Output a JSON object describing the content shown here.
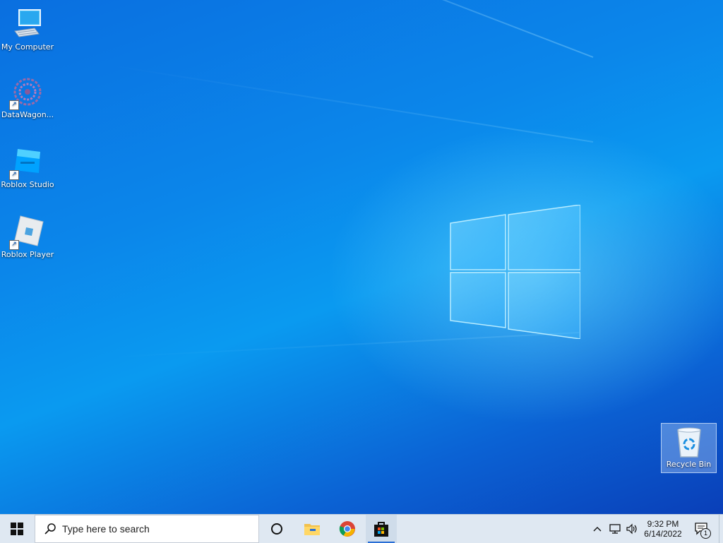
{
  "desktop": {
    "icons": [
      {
        "label": "My Computer",
        "icon": "computer-icon",
        "shortcut": false
      },
      {
        "label": "DataWagon...",
        "icon": "datawagon-icon",
        "shortcut": true
      },
      {
        "label": "Roblox Studio",
        "icon": "roblox-studio-icon",
        "shortcut": true
      },
      {
        "label": "Roblox Player",
        "icon": "roblox-player-icon",
        "shortcut": true
      }
    ],
    "recycle_bin": {
      "label": "Recycle Bin",
      "icon": "recycle-bin-icon",
      "selected": true
    }
  },
  "taskbar": {
    "start_icon": "windows-start-icon",
    "search_placeholder": "Type here to search",
    "search_icon": "search-icon",
    "pinned": [
      {
        "name": "cortana",
        "icon": "cortana-circle-icon"
      },
      {
        "name": "file-explorer",
        "icon": "folder-icon"
      },
      {
        "name": "chrome",
        "icon": "chrome-icon"
      },
      {
        "name": "microsoft-store",
        "icon": "store-bag-icon",
        "active": true
      }
    ],
    "tray": {
      "chevron_icon": "chevron-up-icon",
      "network_icon": "network-icon",
      "volume_icon": "volume-icon",
      "time": "9:32 PM",
      "date": "6/14/2022",
      "notification_icon": "action-center-icon",
      "notification_count": "1"
    }
  },
  "colors": {
    "wallpaper_blue": "#0b86ea",
    "taskbar_bg": "#dfe8f2",
    "accent": "#2a6fd6"
  }
}
